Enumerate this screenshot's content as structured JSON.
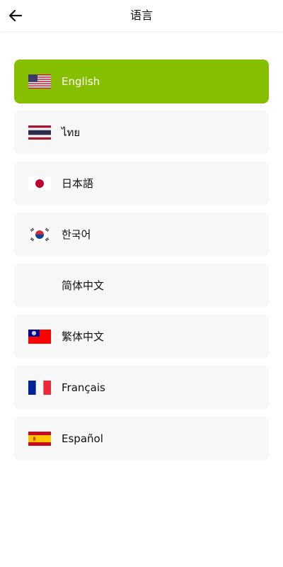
{
  "header": {
    "title": "语言",
    "back_icon": "arrow-left-icon"
  },
  "colors": {
    "selected_bg": "#86bf00",
    "item_bg": "#f7f7f7"
  },
  "languages": [
    {
      "label": "English",
      "flag": "us-flag-icon",
      "selected": true
    },
    {
      "label": "ไทย",
      "flag": "thailand-flag-icon",
      "selected": false
    },
    {
      "label": "日本語",
      "flag": "japan-flag-icon",
      "selected": false
    },
    {
      "label": "한국어",
      "flag": "korea-flag-icon",
      "selected": false
    },
    {
      "label": "简体中文",
      "flag": "",
      "selected": false
    },
    {
      "label": "繁体中文",
      "flag": "taiwan-flag-icon",
      "selected": false
    },
    {
      "label": "Français",
      "flag": "france-flag-icon",
      "selected": false
    },
    {
      "label": "Español",
      "flag": "spain-flag-icon",
      "selected": false
    }
  ]
}
